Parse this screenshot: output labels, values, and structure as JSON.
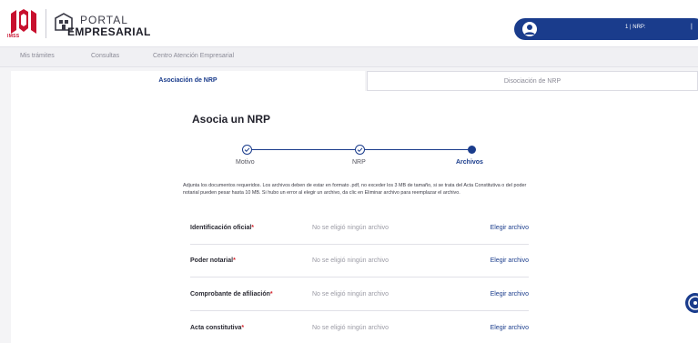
{
  "header": {
    "imss_logo_text": "IMSS",
    "portal_line1": "PORTAL",
    "portal_line2": "EMPRESARIAL",
    "user_nrp": "1 | NRP:",
    "user_rest": "|"
  },
  "nav": {
    "items": [
      "Mis trámites",
      "Consultas",
      "Centro Atención Empresarial"
    ]
  },
  "tabs": {
    "active": "Asociación de NRP",
    "inactive": "Disociación de NRP"
  },
  "main": {
    "title": "Asocia un NRP",
    "steps": [
      {
        "label": "Motivo",
        "state": "done"
      },
      {
        "label": "NRP",
        "state": "done"
      },
      {
        "label": "Archivos",
        "state": "current"
      }
    ],
    "instructions": "Adjunta los documentos requeridos. Los archivos deben de estar en formato .pdf, no exceder los 3 MB de tamaño, si se trata del Acta Constitutiva o del poder notarial pueden pesar hasta 10 MB. Si hubo un error al elegir un archivo, da clic en Eliminar archivo para reemplazar el archivo.",
    "files": [
      {
        "label": "Identificación oficial",
        "required": "*",
        "status": "No se eligió ningún archivo",
        "action": "Elegir archivo"
      },
      {
        "label": "Poder notarial",
        "required": "*",
        "status": "No se eligió ningún archivo",
        "action": "Elegir archivo"
      },
      {
        "label": "Comprobante de afiliación",
        "required": "*",
        "status": "No se eligió ningún archivo",
        "action": "Elegir archivo"
      },
      {
        "label": "Acta constitutiva",
        "required": "*",
        "status": "No se eligió ningún archivo",
        "action": "Elegir archivo"
      }
    ]
  },
  "colors": {
    "brand_blue": "#1a3c8c",
    "imss_red": "#c8102e",
    "required_red": "#d4242c"
  },
  "icons": {
    "imss_logo": "imss-eagle-logo",
    "portal_logo": "portal-building-icon",
    "user": "user-icon",
    "step_done": "check-circle-icon",
    "help": "chat-help-icon"
  }
}
